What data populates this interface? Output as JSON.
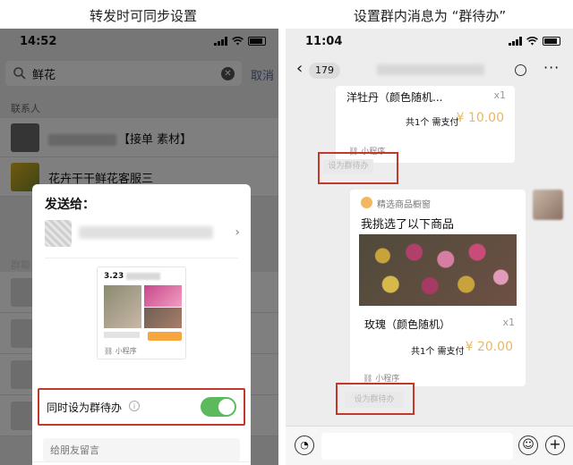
{
  "captions": {
    "left": "转发时可同步设置",
    "right": "设置群内消息为 “群待办”"
  },
  "left_phone": {
    "time": "14:52",
    "search": {
      "query": "鲜花",
      "cancel": "取消"
    },
    "section_contacts": "联系人",
    "contact_1_suffix": "【接单 素材】",
    "contact_2_name": "花卉干干鲜花客服三",
    "section_groups": "群聊",
    "dialog": {
      "title": "发送给：",
      "card_date": "3.23",
      "card_miniprogram": "小程序",
      "toggle_label": "同时设为群待办",
      "toggle_on": true,
      "message_placeholder": "给朋友留言"
    }
  },
  "right_phone": {
    "time": "11:04",
    "unread_count": "179",
    "bubble1": {
      "product": "洋牡丹（颜色随机...",
      "qty": "x1",
      "total": "共1个  需支付",
      "price": "¥ 10.00",
      "miniprogram": "小程序"
    },
    "todo_button": "设为群待办",
    "bubble2": {
      "shop": "精选商品橱窗",
      "headline": "我挑选了以下商品",
      "product": "玫瑰（颜色随机）",
      "qty": "x1",
      "total": "共1个  需支付",
      "price": "¥ 20.00",
      "miniprogram": "小程序"
    }
  },
  "colors": {
    "accent_red": "#c0392b",
    "toggle_green": "#5cba5c",
    "price_gold": "#e7b866"
  },
  "icons": [
    "search-icon",
    "clear-icon",
    "back-icon",
    "circle-icon",
    "more-icon",
    "voice-icon",
    "emoji-icon",
    "plus-icon",
    "chevron-right-icon",
    "info-icon"
  ]
}
